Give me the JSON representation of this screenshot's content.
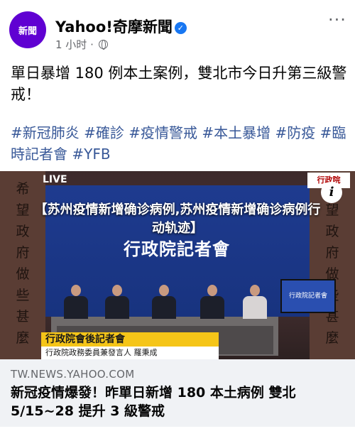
{
  "post": {
    "page_name": "Yahoo!奇摩新聞",
    "avatar_text": "新聞",
    "time": "1 小时",
    "separator": "·",
    "more_label": "···",
    "body": "單日暴增 180 例本土案例，雙北市今日升第三級警戒！",
    "hashtags": "#新冠肺炎 #確診 #疫情警戒 #本土暴增 #防疫 #臨時記者會 #YFB"
  },
  "media": {
    "overlay_title": "【苏州疫情新增确诊病例,苏州疫情新增确诊病例行动轨迹】",
    "banner": "行政院記者會",
    "live": "LIVE",
    "logo": "行政院",
    "screen_text": "行政院記者會",
    "info_icon": "i",
    "left_panel": [
      "希",
      "望",
      "政",
      "府",
      "做",
      "些",
      "甚",
      "麼"
    ],
    "right_panel": [
      "希",
      "望",
      "政",
      "府",
      "做",
      "些",
      "甚",
      "麼"
    ],
    "lower_third_title": "行政院會後記者會",
    "lower_third_sub": "行政院政務委員兼發言人 羅秉成"
  },
  "link": {
    "domain": "TW.NEWS.YAHOO.COM",
    "title": "新冠疫情爆發！昨單日新增 180 本土病例 雙北 5/15~28 提升 3 級警戒"
  },
  "colors": {
    "brand": "#6001d2",
    "hashtag": "#385898",
    "verified": "#1877f2",
    "link_bg": "#f0f2f5"
  }
}
